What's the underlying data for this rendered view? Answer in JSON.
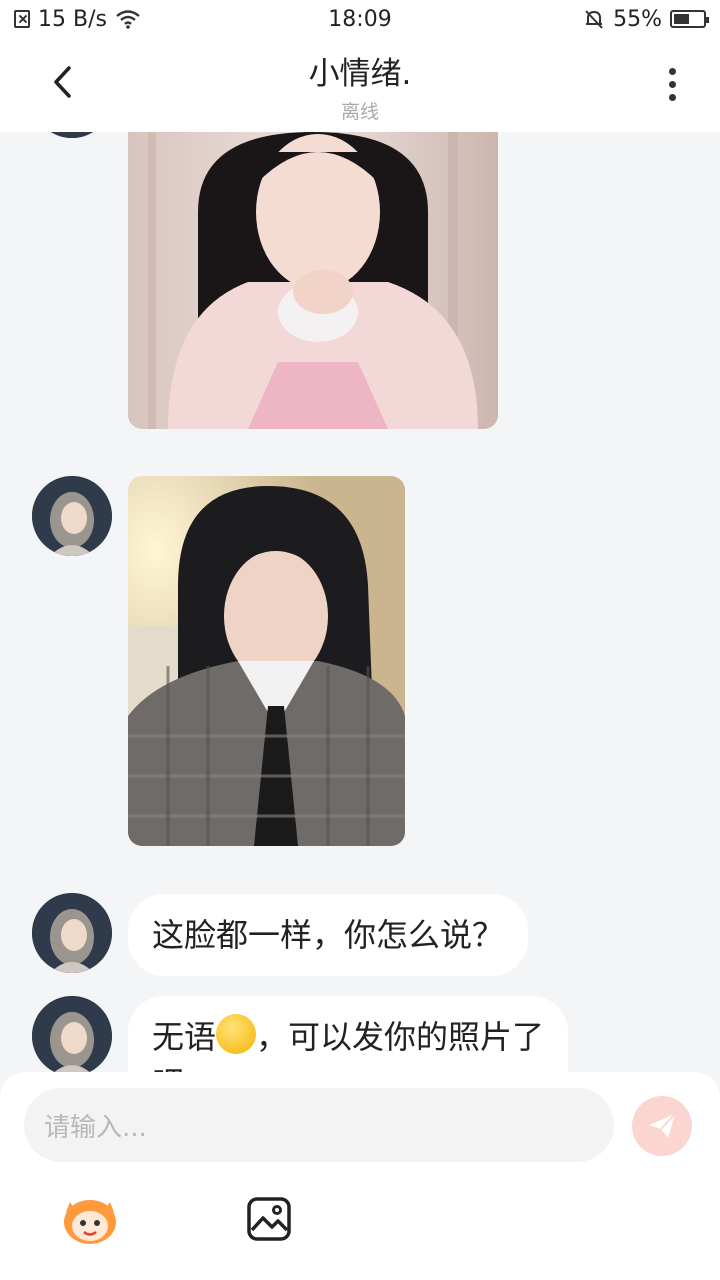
{
  "status_bar": {
    "speed": "15 B/s",
    "time": "18:09",
    "battery": "55%",
    "battery_level": 0.55
  },
  "header": {
    "title": "小情绪.",
    "status": "离线"
  },
  "messages": [
    {
      "type": "image",
      "description": "photo"
    },
    {
      "type": "image",
      "description": "photo"
    },
    {
      "type": "text",
      "text": "这脸都一样，你怎么说？"
    },
    {
      "type": "text",
      "text_before": "无语",
      "emoji": "sweat-smile-emoji",
      "text_after": "，可以发你的照片了",
      "text_line2": "吧"
    }
  ],
  "input": {
    "placeholder": "请输入..."
  },
  "toolbar": {
    "icons": [
      "mascot-icon",
      "image-icon"
    ]
  },
  "colors": {
    "send_button": "#fbd6d0",
    "background": "#f4f5f7"
  }
}
